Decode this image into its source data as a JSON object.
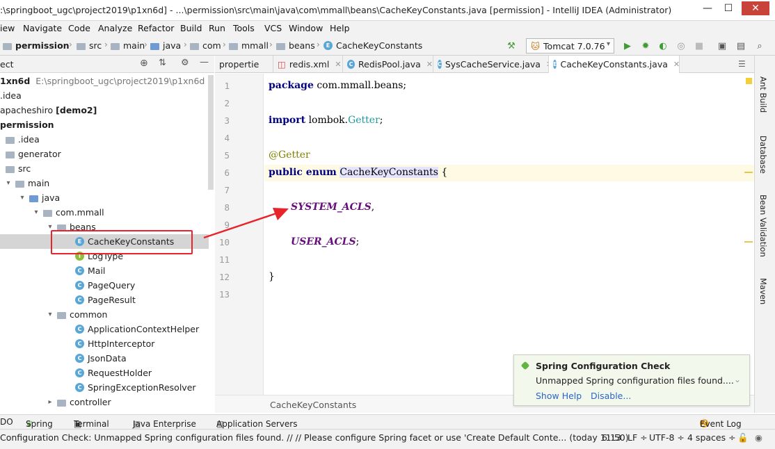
{
  "window": {
    "title": ":\\springboot_ugc\\project2019\\p1xn6d] - ...\\permission\\src\\main\\java\\com\\mmall\\beans\\CacheKeyConstants.java [permission] - IntelliJ IDEA (Administrator)",
    "minimize": "—",
    "maximize": "☐",
    "close": "✕"
  },
  "menu": [
    "View",
    "Navigate",
    "Code",
    "Analyze",
    "Refactor",
    "Build",
    "Run",
    "Tools",
    "VCS",
    "Window",
    "Help"
  ],
  "menu_display": [
    "iew",
    "Navigate",
    "Code",
    "Analyze",
    "Refactor",
    "Build",
    "Run",
    "Tools",
    "VCS",
    "Window",
    "Help"
  ],
  "nav": {
    "crumbs": [
      "permission",
      "src",
      "main",
      "java",
      "com",
      "mmall",
      "beans",
      "CacheKeyConstants"
    ],
    "run_config": "Tomcat 7.0.76"
  },
  "project": {
    "header": "ect",
    "root_name": "1xn6d",
    "root_path": "E:\\springboot_ugc\\project2019\\p1xn6d",
    "items": [
      {
        "label": ".idea",
        "kind": "folder"
      },
      {
        "label": "apacheshiro",
        "suffix": "[demo2]",
        "kind": "module"
      },
      {
        "label": "permission",
        "kind": "module"
      },
      {
        "label": ".idea",
        "kind": "folder"
      },
      {
        "label": "generator",
        "kind": "folder"
      },
      {
        "label": "src",
        "kind": "folder"
      },
      {
        "label": "main",
        "kind": "folder"
      },
      {
        "label": "java",
        "kind": "folder"
      },
      {
        "label": "com.mmall",
        "kind": "package"
      },
      {
        "label": "beans",
        "kind": "package"
      },
      {
        "label": "CacheKeyConstants",
        "kind": "enum"
      },
      {
        "label": "LogType",
        "kind": "interface"
      },
      {
        "label": "Mail",
        "kind": "class"
      },
      {
        "label": "PageQuery",
        "kind": "class"
      },
      {
        "label": "PageResult",
        "kind": "class"
      },
      {
        "label": "common",
        "kind": "package"
      },
      {
        "label": "ApplicationContextHelper",
        "kind": "class"
      },
      {
        "label": "HttpInterceptor",
        "kind": "class"
      },
      {
        "label": "JsonData",
        "kind": "class"
      },
      {
        "label": "RequestHolder",
        "kind": "class"
      },
      {
        "label": "SpringExceptionResolver",
        "kind": "class"
      },
      {
        "label": "controller",
        "kind": "package"
      }
    ]
  },
  "tabs": [
    "propertie",
    "redis.xml",
    "RedisPool.java",
    "SysCacheService.java",
    "CacheKeyConstants.java"
  ],
  "editor": {
    "line_numbers": [
      "1",
      "2",
      "3",
      "4",
      "5",
      "6",
      "7",
      "8",
      "9",
      "10",
      "11",
      "12",
      "13"
    ],
    "package_kw": "package",
    "package_name": "com.mmall.beans;",
    "import_kw": "import",
    "import_pkg": "lombok.",
    "import_cls": "Getter",
    "import_end": ";",
    "annotation": "@Getter",
    "enum_mods": "public enum",
    "enum_name": "CacheKeyConstants",
    "open_brace": "{",
    "const1": "SYSTEM_ACLS",
    "const1_end": ",",
    "const2": "USER_ACLS",
    "const2_end": ";",
    "close_brace": "}",
    "breadcrumb": "CacheKeyConstants"
  },
  "right_tools": [
    "Ant Build",
    "Database",
    "Bean Validation",
    "Maven"
  ],
  "notification": {
    "title": "Spring Configuration Check",
    "body": "Unmapped Spring configuration files found....",
    "action1": "Show Help",
    "action2": "Disable..."
  },
  "bottom_tools": [
    "DO",
    "Spring",
    "Terminal",
    "Java Enterprise",
    "Application Servers"
  ],
  "event_log": {
    "count": "2",
    "label": "Event Log"
  },
  "status": {
    "message": "Configuration Check: Unmapped Spring configuration files found. // // Please configure Spring facet or use 'Create Default Conte... (today 11:50)",
    "position": "6:13",
    "line_sep": "LF ÷",
    "encoding": "UTF-8 ÷",
    "indent": "4 spaces ÷"
  },
  "colors": {
    "keyword": "#000080",
    "annotation": "#808000",
    "enum_constant": "#660e7a",
    "highlight_box": "#e8242a",
    "link": "#2a64c9"
  }
}
